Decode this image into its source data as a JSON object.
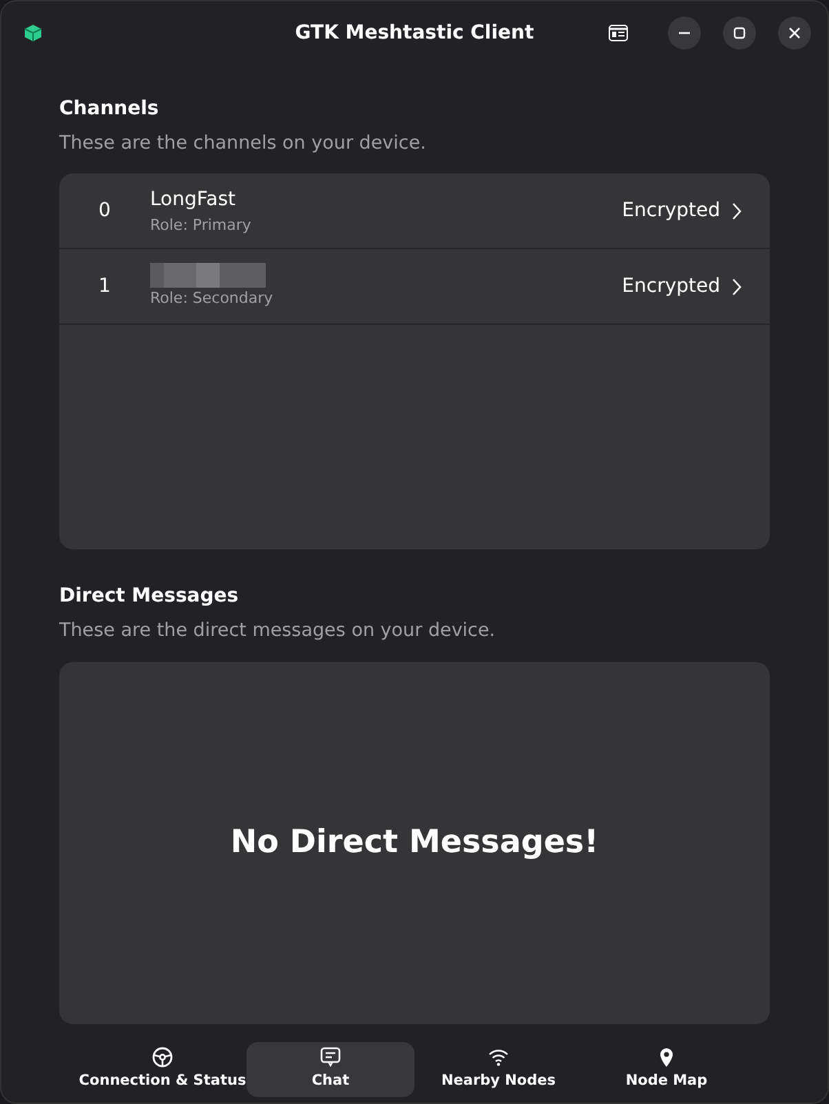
{
  "window": {
    "title": "GTK Meshtastic Client"
  },
  "channels_section": {
    "title": "Channels",
    "subtitle": "These are the channels on your device.",
    "channels": [
      {
        "index": "0",
        "name": "LongFast",
        "redacted": false,
        "role": "Role: Primary",
        "status": "Encrypted"
      },
      {
        "index": "1",
        "redacted": true,
        "role": "Role: Secondary",
        "status": "Encrypted"
      }
    ]
  },
  "direct_messages_section": {
    "title": "Direct Messages",
    "subtitle": "These are the direct messages on your device.",
    "empty_text": "No Direct Messages!"
  },
  "bottom_tabs": [
    {
      "label": "Connection & Status",
      "selected": false
    },
    {
      "label": "Chat",
      "selected": true
    },
    {
      "label": "Nearby Nodes",
      "selected": false
    },
    {
      "label": "Node Map",
      "selected": false
    }
  ]
}
